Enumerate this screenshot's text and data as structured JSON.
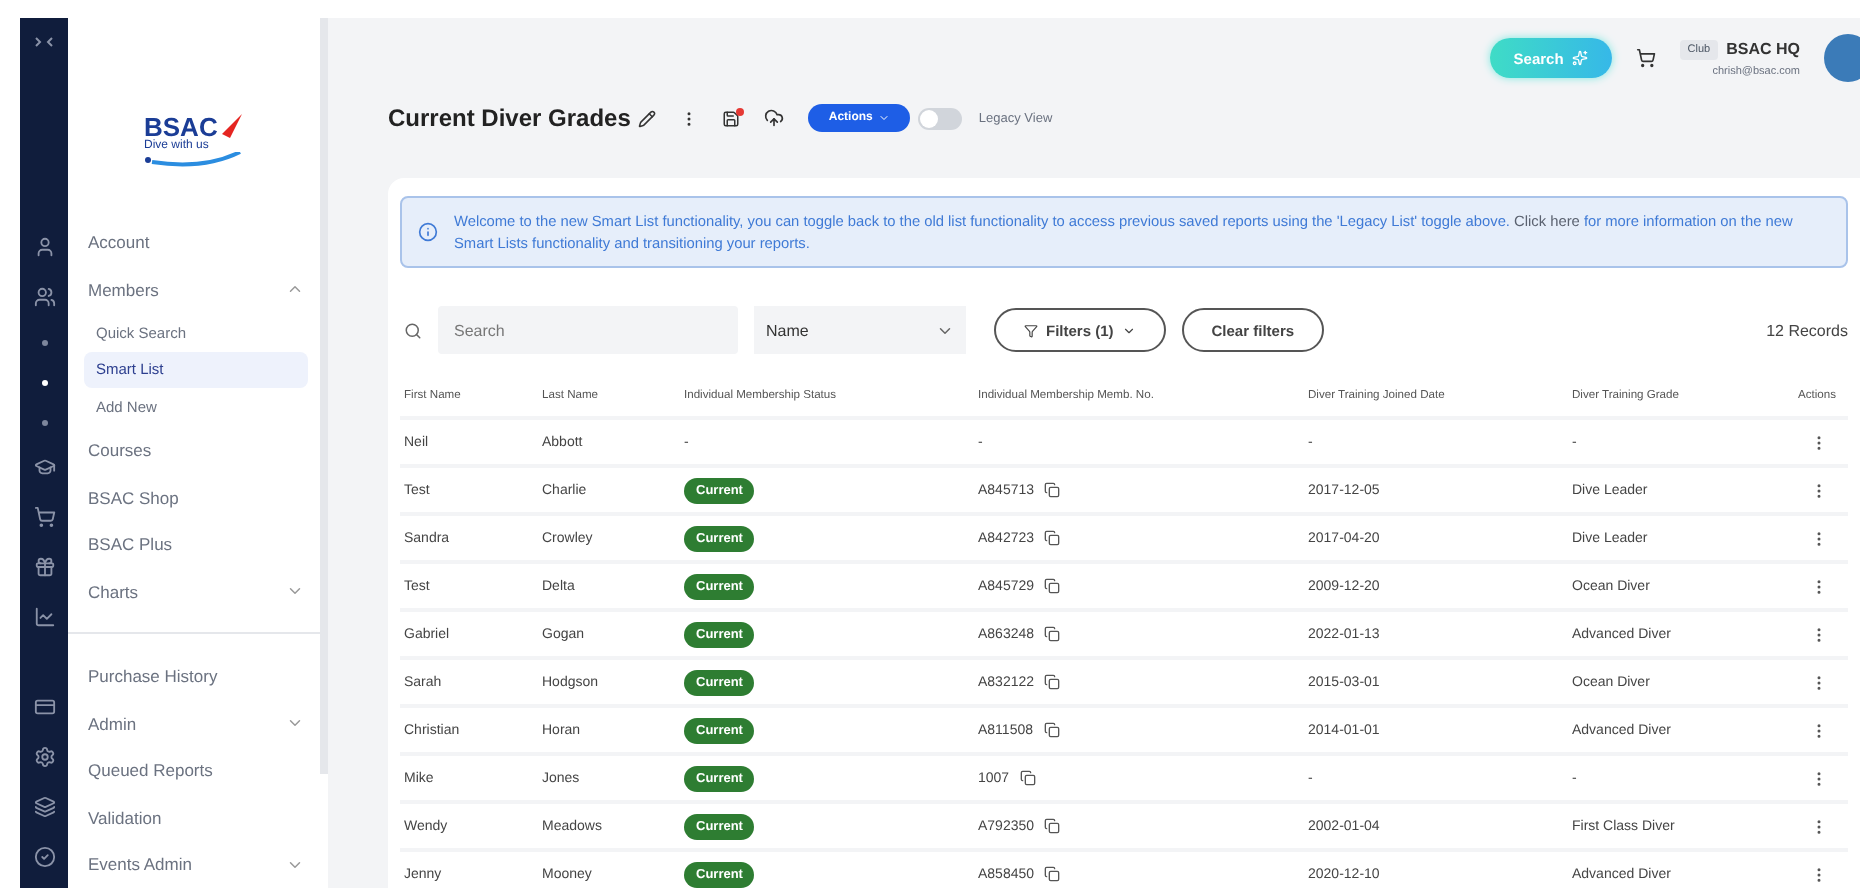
{
  "sidebar": {
    "items": [
      {
        "kind": "item",
        "label": "Account"
      },
      {
        "kind": "item",
        "label": "Members",
        "expanded": true
      },
      {
        "kind": "subitem",
        "label": "Quick Search",
        "selected": false
      },
      {
        "kind": "subitem",
        "label": "Smart List",
        "selected": true
      },
      {
        "kind": "subitem",
        "label": "Add New",
        "selected": false
      },
      {
        "kind": "item",
        "label": "Courses"
      },
      {
        "kind": "item",
        "label": "BSAC Shop"
      },
      {
        "kind": "item",
        "label": "BSAC Plus"
      },
      {
        "kind": "item",
        "label": "Charts",
        "expanded": false
      },
      {
        "kind": "divider"
      },
      {
        "kind": "item",
        "label": "Purchase History"
      },
      {
        "kind": "item",
        "label": "Admin",
        "expanded": false
      },
      {
        "kind": "item",
        "label": "Queued Reports"
      },
      {
        "kind": "item",
        "label": "Validation"
      },
      {
        "kind": "item",
        "label": "Events Admin",
        "expanded": false
      }
    ],
    "logo": {
      "name": "BSAC",
      "tagline": "Dive with us"
    }
  },
  "topbar": {
    "search_button": "Search",
    "club_tag": "Club",
    "club_name": "BSAC HQ",
    "email": "chrish@bsac.com"
  },
  "page": {
    "title": "Current Diver Grades",
    "actions_button": "Actions",
    "legacy_toggle": {
      "label": "Legacy View",
      "on": false
    }
  },
  "banner": {
    "text_before": "Welcome to the new Smart List functionality, you can toggle back to the old list functionality to access previous saved reports using the 'Legacy List' toggle above.",
    "link": "Click here",
    "text_after": "for more information on the new Smart Lists functionality and transitioning your reports."
  },
  "toolbar": {
    "search_placeholder": "Search",
    "field_select": "Name",
    "filters_button": "Filters (1)",
    "clear_button": "Clear filters",
    "record_count": "12 Records"
  },
  "table": {
    "columns": [
      "First Name",
      "Last Name",
      "Individual Membership Status",
      "Individual Membership Memb. No.",
      "Diver Training Joined Date",
      "Diver Training Grade",
      "Actions"
    ],
    "rows": [
      {
        "first": "Neil",
        "last": "Abbott",
        "status": "-",
        "memb_no": "-",
        "joined": "-",
        "grade": "-"
      },
      {
        "first": "Test",
        "last": "Charlie",
        "status": "Current",
        "memb_no": "A845713",
        "joined": "2017-12-05",
        "grade": "Dive Leader"
      },
      {
        "first": "Sandra",
        "last": "Crowley",
        "status": "Current",
        "memb_no": "A842723",
        "joined": "2017-04-20",
        "grade": "Dive Leader"
      },
      {
        "first": "Test",
        "last": "Delta",
        "status": "Current",
        "memb_no": "A845729",
        "joined": "2009-12-20",
        "grade": "Ocean Diver"
      },
      {
        "first": "Gabriel",
        "last": "Gogan",
        "status": "Current",
        "memb_no": "A863248",
        "joined": "2022-01-13",
        "grade": "Advanced Diver"
      },
      {
        "first": "Sarah",
        "last": "Hodgson",
        "status": "Current",
        "memb_no": "A832122",
        "joined": "2015-03-01",
        "grade": "Ocean Diver"
      },
      {
        "first": "Christian",
        "last": "Horan",
        "status": "Current",
        "memb_no": "A811508",
        "joined": "2014-01-01",
        "grade": "Advanced Diver"
      },
      {
        "first": "Mike",
        "last": "Jones",
        "status": "Current",
        "memb_no": "1007",
        "joined": "-",
        "grade": "-"
      },
      {
        "first": "Wendy",
        "last": "Meadows",
        "status": "Current",
        "memb_no": "A792350",
        "joined": "2002-01-04",
        "grade": "First Class Diver"
      },
      {
        "first": "Jenny",
        "last": "Mooney",
        "status": "Current",
        "memb_no": "A858450",
        "joined": "2020-12-10",
        "grade": "Advanced Diver"
      }
    ]
  }
}
